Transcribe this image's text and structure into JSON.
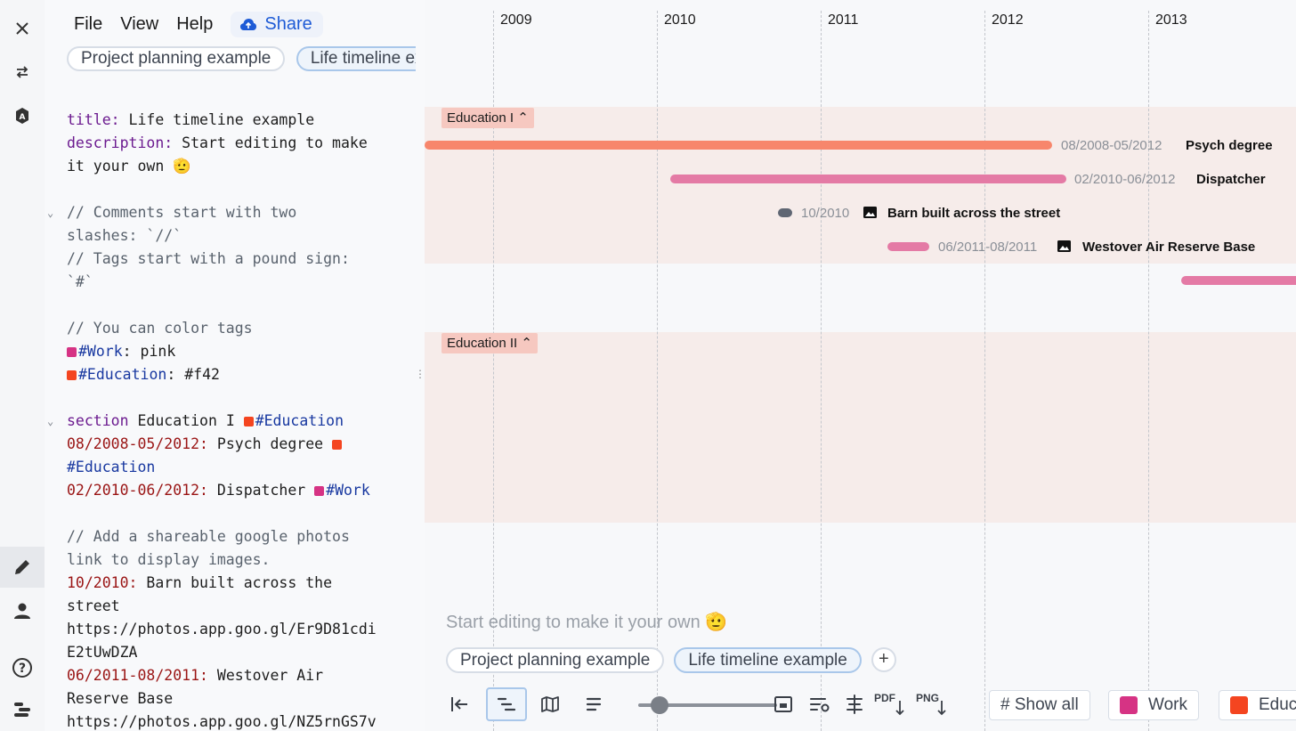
{
  "menu": {
    "file": "File",
    "view": "View",
    "help": "Help",
    "share": "Share"
  },
  "doc_tabs": [
    "Project planning example",
    "Life timeline example"
  ],
  "code": {
    "l1_key": "title:",
    "l1_val": " Life timeline example",
    "l2_key": "description:",
    "l2_val": " Start editing to make",
    "l3": "it your own 🫡",
    "l5": "// Comments start with two",
    "l6": "slashes: `//`",
    "l7": "// Tags start with a pound sign:",
    "l8": "`#`",
    "l10": "// You can color tags",
    "l11_tag": "#Work",
    "l11_val": ": pink",
    "l12_tag": "#Education",
    "l12_val": ": #f42",
    "l14_key": "section",
    "l14_val": " Education I ",
    "l14_tag": "#Education",
    "l15_date": "08/2008-05/2012:",
    "l15_val": " Psych degree ",
    "l16_tag": "#Education",
    "l17_date": "02/2010-06/2012:",
    "l17_val": " Dispatcher ",
    "l17_tag": "#Work",
    "l19": "// Add a shareable google photos",
    "l20": "link to display images.",
    "l21_date": "10/2010:",
    "l21_val": " Barn built across the",
    "l22": "street",
    "l23": "https://photos.app.goo.gl/Er9D81cdi",
    "l24": "E2tUwDZA",
    "l25_date": "06/2011-08/2011:",
    "l25_val": " Westover Air",
    "l26": "Reserve Base",
    "l27": "https://photos.app.goo.gl/NZ5rnGS7v"
  },
  "colors": {
    "work": "#d63384",
    "education": "#f44520",
    "accent": "#1e5bd6",
    "bar_education": "#f7866c",
    "bar_work": "#e47aa5"
  },
  "years": [
    "2009",
    "2010",
    "2011",
    "2012",
    "2013"
  ],
  "sections": [
    {
      "label": "Education I ⌃"
    },
    {
      "label": "Education II ⌃"
    }
  ],
  "events": [
    {
      "date": "08/2008-05/2012",
      "title": "Psych degree"
    },
    {
      "date": "02/2010-06/2012",
      "title": "Dispatcher"
    },
    {
      "date": "10/2010",
      "title": "Barn built across the street"
    },
    {
      "date": "06/2011-08/2011",
      "title": "Westover Air Reserve Base"
    }
  ],
  "description": "Start editing to make it your own 🫡",
  "tl_tabs": [
    "Project planning example",
    "Life timeline example"
  ],
  "add_tab": "+",
  "toolbar": {
    "pdf": "PDF",
    "png": "PNG",
    "show_all": "# Show all",
    "work": "Work",
    "education": "Education"
  }
}
